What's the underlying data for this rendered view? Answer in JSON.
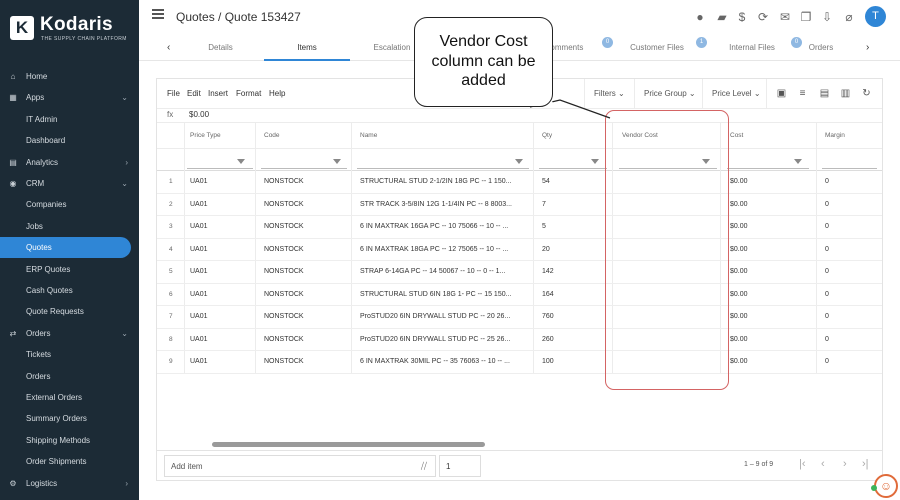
{
  "brand": {
    "name": "Kodaris",
    "mark": "K",
    "tagline": "THE SUPPLY CHAIN PLATFORM"
  },
  "sidebar": {
    "items": [
      {
        "label": "Home",
        "icon": "home-icon",
        "glyph": "⌂"
      },
      {
        "label": "Apps",
        "icon": "grid-icon",
        "glyph": "▦",
        "chevron": "⌄"
      },
      {
        "label": "IT Admin",
        "sub": true
      },
      {
        "label": "Dashboard",
        "sub": true
      },
      {
        "label": "Analytics",
        "icon": "chart-icon",
        "glyph": "▤",
        "chevron": "›"
      },
      {
        "label": "CRM",
        "icon": "crm-icon",
        "glyph": "◉",
        "chevron": "⌄"
      },
      {
        "label": "Companies",
        "sub": true
      },
      {
        "label": "Jobs",
        "sub": true
      },
      {
        "label": "Quotes",
        "sub": true,
        "active": true
      },
      {
        "label": "ERP Quotes",
        "sub": true
      },
      {
        "label": "Cash Quotes",
        "sub": true
      },
      {
        "label": "Quote Requests",
        "sub": true
      },
      {
        "label": "Orders",
        "icon": "orders-icon",
        "glyph": "⇄",
        "chevron": "⌄"
      },
      {
        "label": "Tickets",
        "sub": true
      },
      {
        "label": "Orders",
        "sub": true
      },
      {
        "label": "External Orders",
        "sub": true
      },
      {
        "label": "Summary Orders",
        "sub": true
      },
      {
        "label": "Shipping Methods",
        "sub": true
      },
      {
        "label": "Order Shipments",
        "sub": true
      },
      {
        "label": "Logistics",
        "icon": "logistics-icon",
        "glyph": "⚙",
        "chevron": "›"
      }
    ]
  },
  "header": {
    "title": "Quotes / Quote 153427",
    "avatar": "T",
    "icons": [
      {
        "name": "location-pin-icon",
        "glyph": "●"
      },
      {
        "name": "truck-icon",
        "glyph": "▰"
      },
      {
        "name": "dollar-bill-icon",
        "glyph": "$"
      },
      {
        "name": "refresh-dollar-icon",
        "glyph": "⟳"
      },
      {
        "name": "mail-icon",
        "glyph": "✉"
      },
      {
        "name": "copy-icon",
        "glyph": "❐"
      },
      {
        "name": "download-file-icon",
        "glyph": "⇩"
      },
      {
        "name": "paperclip-icon",
        "glyph": "⌀"
      }
    ]
  },
  "tabs": [
    {
      "label": "Details"
    },
    {
      "label": "Items",
      "active": true
    },
    {
      "label": "Escalation"
    },
    {
      "label": "Comments",
      "badge": "0"
    },
    {
      "label": "Customer Files",
      "badge": "1"
    },
    {
      "label": "Internal Files",
      "badge": "0"
    },
    {
      "label": "Orders"
    }
  ],
  "toolbar": {
    "menus": [
      "File",
      "Edit",
      "Insert",
      "Format",
      "Help"
    ],
    "dropdowns": [
      "Filters",
      "Price Group",
      "Price Level"
    ],
    "icons": [
      "dollar-icon",
      "add-row-icon",
      "comment-icon",
      "columns-icon",
      "reload-icon"
    ]
  },
  "formula": {
    "label": "fx",
    "value": "$0.00"
  },
  "grid": {
    "columns": [
      "Price Type",
      "Code",
      "Name",
      "Qty",
      "Vendor Cost",
      "Cost",
      "Margin"
    ],
    "rows": [
      {
        "n": "1",
        "price_type": "UA01",
        "code": "NONSTOCK",
        "name": "STRUCTURAL STUD 2-1/2IN 18G PC -- 1 150...",
        "qty": "54",
        "vendor_cost": "",
        "cost": "$0.00",
        "margin": "0"
      },
      {
        "n": "2",
        "price_type": "UA01",
        "code": "NONSTOCK",
        "name": "STR TRACK 3-5/8IN 12G 1-1/4IN PC -- 8 8003...",
        "qty": "7",
        "vendor_cost": "",
        "cost": "$0.00",
        "margin": "0"
      },
      {
        "n": "3",
        "price_type": "UA01",
        "code": "NONSTOCK",
        "name": "6 IN MAXTRAK 16GA PC -- 10 75066 -- 10 -- ...",
        "qty": "5",
        "vendor_cost": "",
        "cost": "$0.00",
        "margin": "0"
      },
      {
        "n": "4",
        "price_type": "UA01",
        "code": "NONSTOCK",
        "name": "6 IN MAXTRAK 18GA PC -- 12 75065 -- 10 -- ...",
        "qty": "20",
        "vendor_cost": "",
        "cost": "$0.00",
        "margin": "0"
      },
      {
        "n": "5",
        "price_type": "UA01",
        "code": "NONSTOCK",
        "name": "STRAP 6-14GA PC -- 14 50067 -- 10 -- 0 -- 1...",
        "qty": "142",
        "vendor_cost": "",
        "cost": "$0.00",
        "margin": "0"
      },
      {
        "n": "6",
        "price_type": "UA01",
        "code": "NONSTOCK",
        "name": "STRUCTURAL STUD 6IN 18G 1- PC -- 15 150...",
        "qty": "164",
        "vendor_cost": "",
        "cost": "$0.00",
        "margin": "0"
      },
      {
        "n": "7",
        "price_type": "UA01",
        "code": "NONSTOCK",
        "name": "ProSTUD20 6IN DRYWALL STUD PC -- 20 26...",
        "qty": "760",
        "vendor_cost": "",
        "cost": "$0.00",
        "margin": "0"
      },
      {
        "n": "8",
        "price_type": "UA01",
        "code": "NONSTOCK",
        "name": "ProSTUD20 6IN DRYWALL STUD PC -- 25 26...",
        "qty": "260",
        "vendor_cost": "",
        "cost": "$0.00",
        "margin": "0"
      },
      {
        "n": "9",
        "price_type": "UA01",
        "code": "NONSTOCK",
        "name": "6 IN MAXTRAK 30MIL PC -- 35 76063 -- 10 -- ...",
        "qty": "100",
        "vendor_cost": "",
        "cost": "$0.00",
        "margin": "0"
      }
    ]
  },
  "footer": {
    "add_placeholder": "Add item",
    "qty": "1",
    "range": "1 – 9 of 9"
  },
  "annotation": {
    "callout": "Vendor Cost column can be added"
  },
  "colors": {
    "sidebar": "#1c2b36",
    "accent": "#2f86d6",
    "highlight": "#d46464",
    "chat": "#e06b3a"
  }
}
